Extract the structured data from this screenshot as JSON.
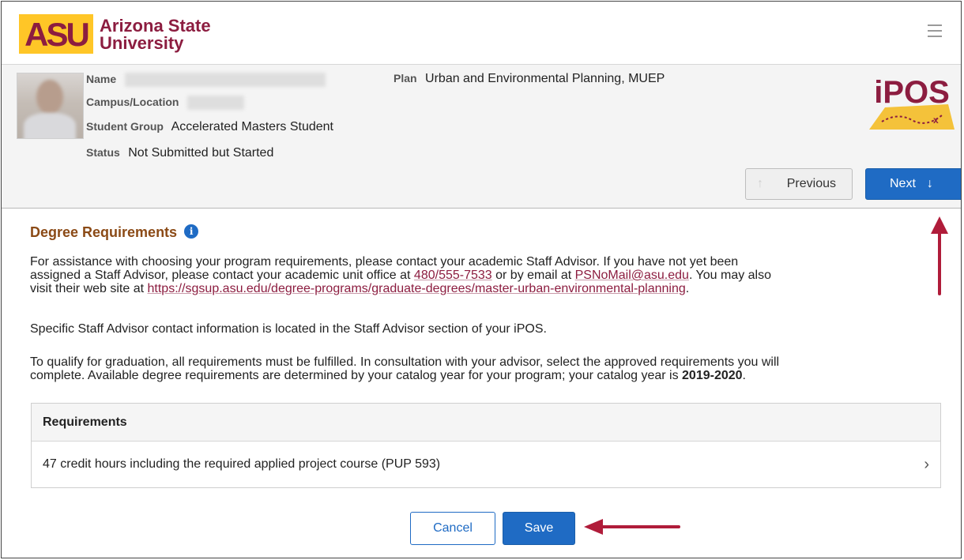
{
  "header": {
    "university_line1": "Arizona State",
    "university_line2": "University",
    "logo_mark": "ASU",
    "menu_icon": "hamburger-menu-icon"
  },
  "student": {
    "name_label": "Name",
    "campus_label": "Campus/Location",
    "group_label": "Student Group",
    "group_value": "Accelerated Masters Student",
    "status_label": "Status",
    "status_value": "Not Submitted but Started",
    "plan_label": "Plan",
    "plan_value": "Urban and Environmental Planning, MUEP",
    "ipos_logo_text": "iPOS"
  },
  "nav": {
    "previous_label": "Previous",
    "next_label": "Next"
  },
  "section": {
    "title": "Degree Requirements",
    "info_icon": "i",
    "p1_a": "For assistance with choosing your program requirements, please contact your academic Staff Advisor. If you have not yet been",
    "p1_b_pre": "assigned a Staff Advisor, please contact your academic unit office at ",
    "phone": "480/555-7533",
    "p1_b_mid": " or by email at ",
    "email": "PSNoMail@asu.edu",
    "p1_b_post": ". You may also",
    "p1_c_pre": "visit their web site at ",
    "url": "https://sgsup.asu.edu/degree-programs/graduate-degrees/master-urban-environmental-planning",
    "p1_c_post": ".",
    "p2": "Specific Staff Advisor contact information is located in the Staff Advisor section of your iPOS.",
    "p3_a": "To qualify for graduation, all requirements must be fulfilled. In consultation with your advisor, select the approved requirements you will",
    "p3_b_pre": "complete. Available degree requirements are determined by your catalog year for your program; your catalog year is ",
    "catalog_year": "2019-2020",
    "p3_b_post": "."
  },
  "requirements": {
    "header": "Requirements",
    "rows": [
      {
        "label": "47 credit hours including the required applied project course (PUP 593)"
      }
    ]
  },
  "actions": {
    "cancel_label": "Cancel",
    "save_label": "Save"
  },
  "colors": {
    "asu_maroon": "#8c1d40",
    "asu_gold": "#ffc627",
    "primary_blue": "#1f6bc4",
    "title_brown": "#8b4a16",
    "annotation_red": "#b01c3a"
  }
}
